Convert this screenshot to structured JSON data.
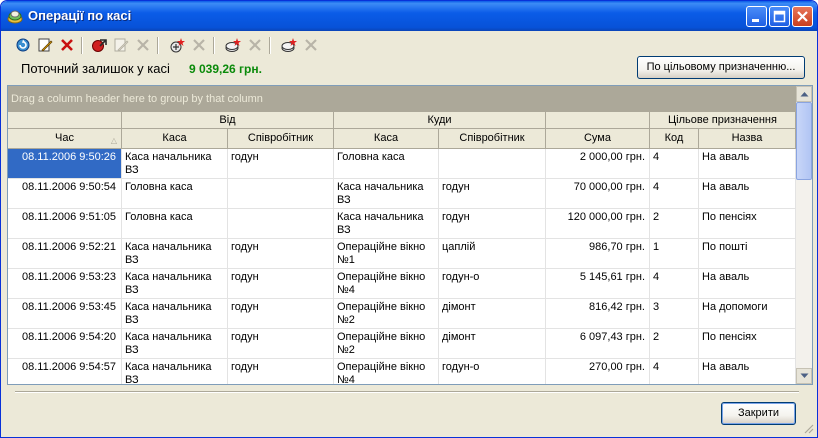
{
  "window": {
    "title": "Операції по касі",
    "controls": [
      "minimize-icon",
      "maximize-icon",
      "close-icon"
    ]
  },
  "toolbar": {
    "icons": [
      "refresh-icon",
      "edit-icon",
      "delete-icon",
      "transfer-icon",
      "edit-icon",
      "delete-icon",
      "add-icon",
      "delete-icon",
      "add-icon",
      "delete-icon",
      "add-icon",
      "delete-icon"
    ]
  },
  "balance": {
    "label": "Поточний залишок у касі",
    "value": "9 039,26 грн."
  },
  "buttons": {
    "by_purpose": "По цільовому призначенню...",
    "close": "Закрити"
  },
  "grid": {
    "group_panel_hint": "Drag a column header here to group by that column",
    "bands": {
      "from": "Від",
      "to": "Куди",
      "purpose": "Цільове призначення"
    },
    "columns": {
      "time": "Час",
      "from_cash": "Каса",
      "from_employee": "Співробітник",
      "to_cash": "Каса",
      "to_employee": "Співробітник",
      "sum": "Сума",
      "code": "Код",
      "name": "Назва"
    },
    "rows": [
      {
        "time": "08.11.2006 9:50:26",
        "from_cash": "Каса начальника ВЗ",
        "from_employee": "годун",
        "to_cash": "Головна каса",
        "to_employee": "",
        "sum": "2 000,00 грн.",
        "code": "4",
        "name": "На аваль"
      },
      {
        "time": "08.11.2006 9:50:54",
        "from_cash": "Головна каса",
        "from_employee": "",
        "to_cash": "Каса начальника ВЗ",
        "to_employee": "годун",
        "sum": "70 000,00 грн.",
        "code": "4",
        "name": "На аваль"
      },
      {
        "time": "08.11.2006 9:51:05",
        "from_cash": "Головна каса",
        "from_employee": "",
        "to_cash": "Каса начальника ВЗ",
        "to_employee": "годун",
        "sum": "120 000,00 грн.",
        "code": "2",
        "name": "По пенсіях"
      },
      {
        "time": "08.11.2006 9:52:21",
        "from_cash": "Каса начальника ВЗ",
        "from_employee": "годун",
        "to_cash": "Операційне вікно №1",
        "to_employee": "цаплій",
        "sum": "986,70 грн.",
        "code": "1",
        "name": "По пошті"
      },
      {
        "time": "08.11.2006 9:53:23",
        "from_cash": "Каса начальника ВЗ",
        "from_employee": "годун",
        "to_cash": "Операційне вікно №4",
        "to_employee": "годун-о",
        "sum": "5 145,61 грн.",
        "code": "4",
        "name": "На аваль"
      },
      {
        "time": "08.11.2006 9:53:45",
        "from_cash": "Каса начальника ВЗ",
        "from_employee": "годун",
        "to_cash": "Операційне вікно №2",
        "to_employee": "дімонт",
        "sum": "816,42 грн.",
        "code": "3",
        "name": "На допомоги"
      },
      {
        "time": "08.11.2006 9:54:20",
        "from_cash": "Каса начальника ВЗ",
        "from_employee": "годун",
        "to_cash": "Операційне вікно №2",
        "to_employee": "дімонт",
        "sum": "6 097,43 грн.",
        "code": "2",
        "name": "По пенсіях"
      },
      {
        "time": "08.11.2006 9:54:57",
        "from_cash": "Каса начальника ВЗ",
        "from_employee": "годун",
        "to_cash": "Операційне вікно №4",
        "to_employee": "годун-о",
        "sum": "270,00 грн.",
        "code": "4",
        "name": "На аваль"
      }
    ]
  },
  "colors": {
    "titlebar": "#0a5be7",
    "selection": "#316ac5",
    "balance_value": "#0a8a0a"
  }
}
